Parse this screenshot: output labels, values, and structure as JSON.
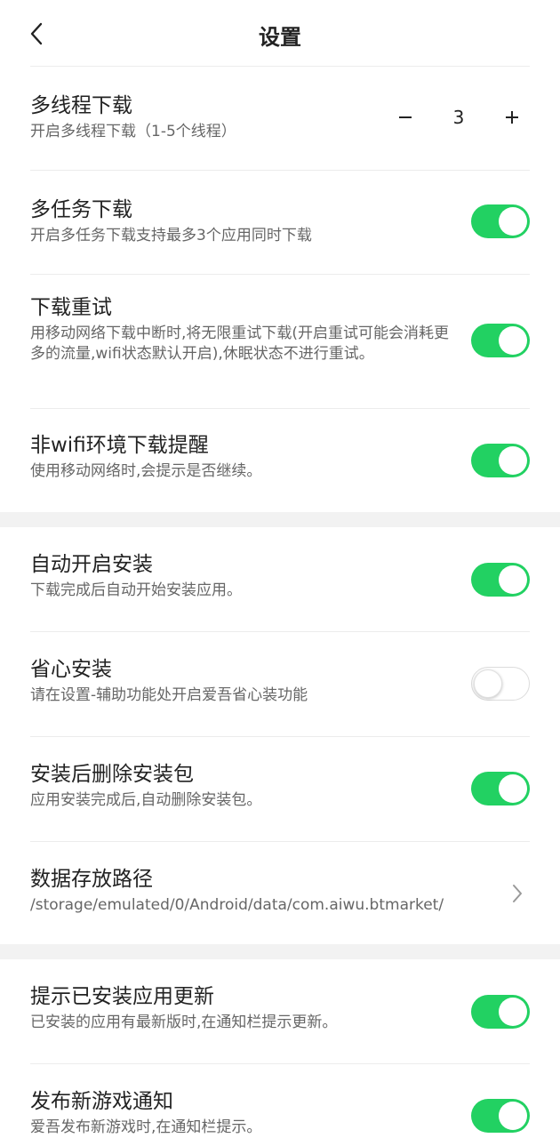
{
  "header": {
    "title": "设置",
    "back_icon": "chevron-left-icon"
  },
  "colors": {
    "accent": "#22d162",
    "section_gap": "#f2f2f2",
    "divider": "#ececec"
  },
  "sections": [
    {
      "items": [
        {
          "title": "多线程下载",
          "desc": "开启多线程下载（1-5个线程）",
          "control": "stepper",
          "value": "3",
          "minus": "−",
          "plus": "+"
        },
        {
          "title": "多任务下载",
          "desc": "开启多任务下载支持最多3个应用同时下载",
          "control": "toggle",
          "on": true
        },
        {
          "title": "下载重试",
          "desc": "用移动网络下载中断时,将无限重试下载(开启重试可能会消耗更多的流量,wifi状态默认开启),休眠状态不进行重试。",
          "control": "toggle",
          "on": true
        },
        {
          "title": "非wifi环境下载提醒",
          "desc": "使用移动网络时,会提示是否继续。",
          "control": "toggle",
          "on": true
        }
      ]
    },
    {
      "items": [
        {
          "title": "自动开启安装",
          "desc": "下载完成后自动开始安装应用。",
          "control": "toggle",
          "on": true
        },
        {
          "title": "省心安装",
          "desc": "请在设置-辅助功能处开启爱吾省心装功能",
          "control": "toggle",
          "on": false
        },
        {
          "title": "安装后删除安装包",
          "desc": "应用安装完成后,自动删除安装包。",
          "control": "toggle",
          "on": true
        },
        {
          "title": "数据存放路径",
          "desc": "/storage/emulated/0/Android/data/com.aiwu.btmarket/",
          "control": "chevron",
          "icon": "chevron-right-icon"
        }
      ]
    },
    {
      "items": [
        {
          "title": "提示已安装应用更新",
          "desc": "已安装的应用有最新版时,在通知栏提示更新。",
          "control": "toggle",
          "on": true
        },
        {
          "title": "发布新游戏通知",
          "desc": "爱吾发布新游戏时,在通知栏提示。",
          "control": "toggle",
          "on": true
        }
      ]
    }
  ]
}
